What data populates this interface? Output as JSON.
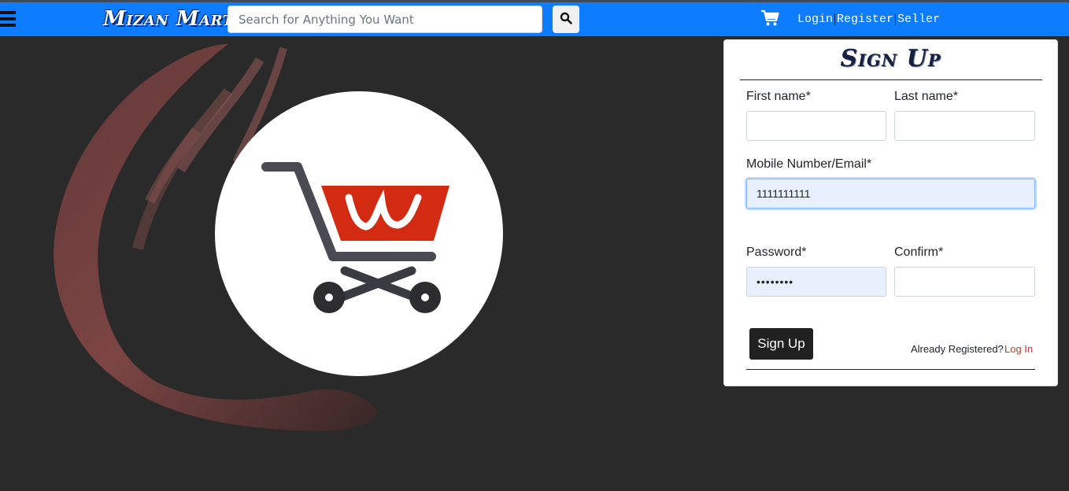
{
  "nav": {
    "brand": "Mizan Mart",
    "search_placeholder": "Search for Anything You Want",
    "login": "Login",
    "register": "Register",
    "seller": "Seller"
  },
  "signup": {
    "title": "Sign Up",
    "first_name_label": "First name*",
    "last_name_label": "Last name*",
    "contact_label": "Mobile Number/Email*",
    "contact_value": "1111111111",
    "password_label": "Password*",
    "password_value": "••••••••",
    "confirm_label": "Confirm*",
    "submit_label": "Sign Up",
    "already_text": "Already Registered?",
    "login_link": "Log In"
  },
  "colors": {
    "navbar": "#0d7cff",
    "background": "#2a2a2a",
    "logo_red": "#d32a12",
    "cart_gray": "#4a4a52"
  },
  "icons": [
    "hamburger-icon",
    "search-icon",
    "cart-icon",
    "shopping-cart-logo"
  ]
}
